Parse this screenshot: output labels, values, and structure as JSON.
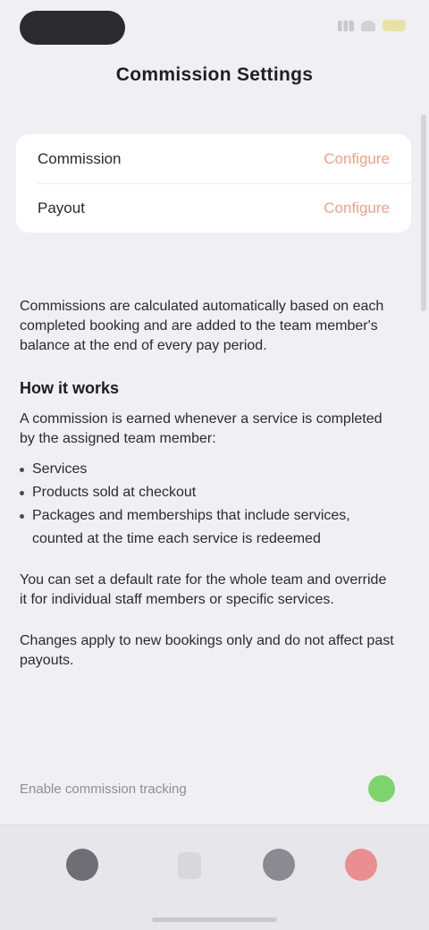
{
  "status_bar": {
    "time": "",
    "icons": [
      "signal-icon",
      "wifi-icon",
      "battery-icon"
    ]
  },
  "nav": {
    "title": "Commission Settings"
  },
  "settings": {
    "rows": [
      {
        "label": "Commission",
        "action": "Configure"
      },
      {
        "label": "Payout",
        "action": "Configure"
      }
    ]
  },
  "content": {
    "intro": "Commissions are calculated automatically based on each completed booking and are added to the team member's balance at the end of every pay period.",
    "heading": "How it works",
    "section_text": "A commission is earned whenever a service is completed by the assigned team member:",
    "bullets": [
      "Services",
      "Products sold at checkout",
      "Packages and memberships that include services, counted at the time each service is redeemed"
    ],
    "para2": "You can set a default rate for the whole team and override it for individual staff members or specific services.",
    "para3": "Changes apply to new bookings only and do not affect past payouts."
  },
  "toggle": {
    "label": "Enable commission tracking",
    "state": "on"
  },
  "tab_bar": {
    "items": [
      {
        "label": "",
        "icon": "calendar-icon"
      },
      {
        "label": "",
        "icon": "document-icon"
      },
      {
        "label": "",
        "icon": "profile-icon"
      },
      {
        "label": "",
        "icon": "settings-icon"
      }
    ]
  },
  "colors": {
    "background": "#f0f0f4",
    "card": "#ffffff",
    "accent": "#f4a08a",
    "toggle_on": "#7dd46c",
    "tab_active": "#ea8e92"
  }
}
